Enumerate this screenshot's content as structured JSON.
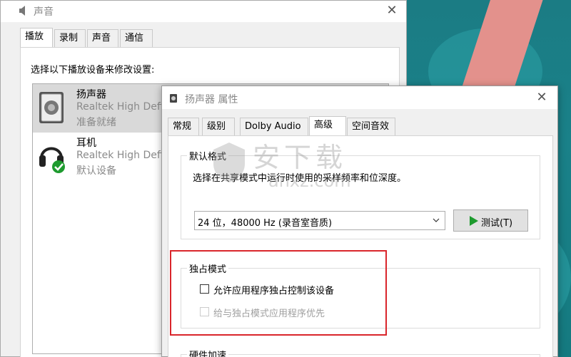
{
  "sound_window": {
    "title": "声音",
    "tabs": [
      {
        "label": "播放",
        "active": true
      },
      {
        "label": "录制",
        "active": false
      },
      {
        "label": "声音",
        "active": false
      },
      {
        "label": "通信",
        "active": false
      }
    ],
    "instruction": "选择以下播放设备来修改设置:",
    "devices": [
      {
        "name": "扬声器",
        "driver": "Realtek High Defi",
        "status": "准备就绪",
        "icon": "speaker-icon",
        "selected": true
      },
      {
        "name": "耳机",
        "driver": "Realtek High Defi",
        "status": "默认设备",
        "icon": "headphones-icon",
        "selected": false
      }
    ]
  },
  "properties_dialog": {
    "title": "扬声器 属性",
    "tabs": [
      {
        "label": "常规",
        "active": false
      },
      {
        "label": "级别",
        "active": false
      },
      {
        "label": "Dolby Audio",
        "active": false
      },
      {
        "label": "高级",
        "active": true
      },
      {
        "label": "空间音效",
        "active": false
      }
    ],
    "default_format": {
      "group_title": "默认格式",
      "description": "选择在共享模式中运行时使用的采样频率和位深度。",
      "selected_format": "24 位，48000 Hz (录音室音质)",
      "test_button_label": "测试(T)"
    },
    "exclusive_mode": {
      "group_title": "独占模式",
      "allow_exclusive_label": "允许应用程序独占控制该设备",
      "allow_exclusive_checked": false,
      "priority_label": "给与独占模式应用程序优先",
      "priority_checked": false,
      "priority_enabled": false
    },
    "hardware_accel": {
      "group_title": "硬件加速"
    }
  },
  "watermark": {
    "cn": "安下载",
    "en": "anxz.com"
  },
  "colors": {
    "highlight_border": "#d9252b",
    "play_icon": "#1e9b2f",
    "check_badge": "#1e9b2f"
  }
}
